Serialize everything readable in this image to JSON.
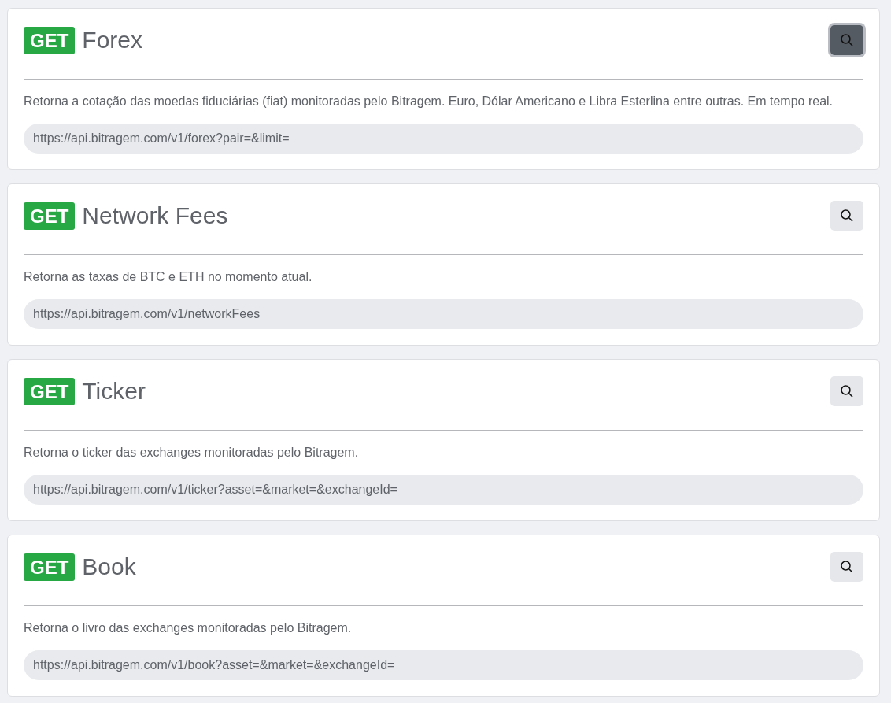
{
  "endpoints": [
    {
      "method": "GET",
      "title": "Forex",
      "focused": true,
      "description": "Retorna a cotação das moedas fiduciárias (fiat) monitoradas pelo Bitragem. Euro, Dólar Americano e Libra Esterlina entre outras. Em tempo real.",
      "url": "https://api.bitragem.com/v1/forex?pair=&limit="
    },
    {
      "method": "GET",
      "title": "Network Fees",
      "focused": false,
      "description": "Retorna as taxas de BTC e ETH no momento atual.",
      "url": "https://api.bitragem.com/v1/networkFees"
    },
    {
      "method": "GET",
      "title": "Ticker",
      "focused": false,
      "description": "Retorna o ticker das exchanges monitoradas pelo Bitragem.",
      "url": "https://api.bitragem.com/v1/ticker?asset=&market=&exchangeId="
    },
    {
      "method": "GET",
      "title": "Book",
      "focused": false,
      "description": "Retorna o livro das exchanges monitoradas pelo Bitragem.",
      "url": "https://api.bitragem.com/v1/book?asset=&market=&exchangeId="
    }
  ]
}
